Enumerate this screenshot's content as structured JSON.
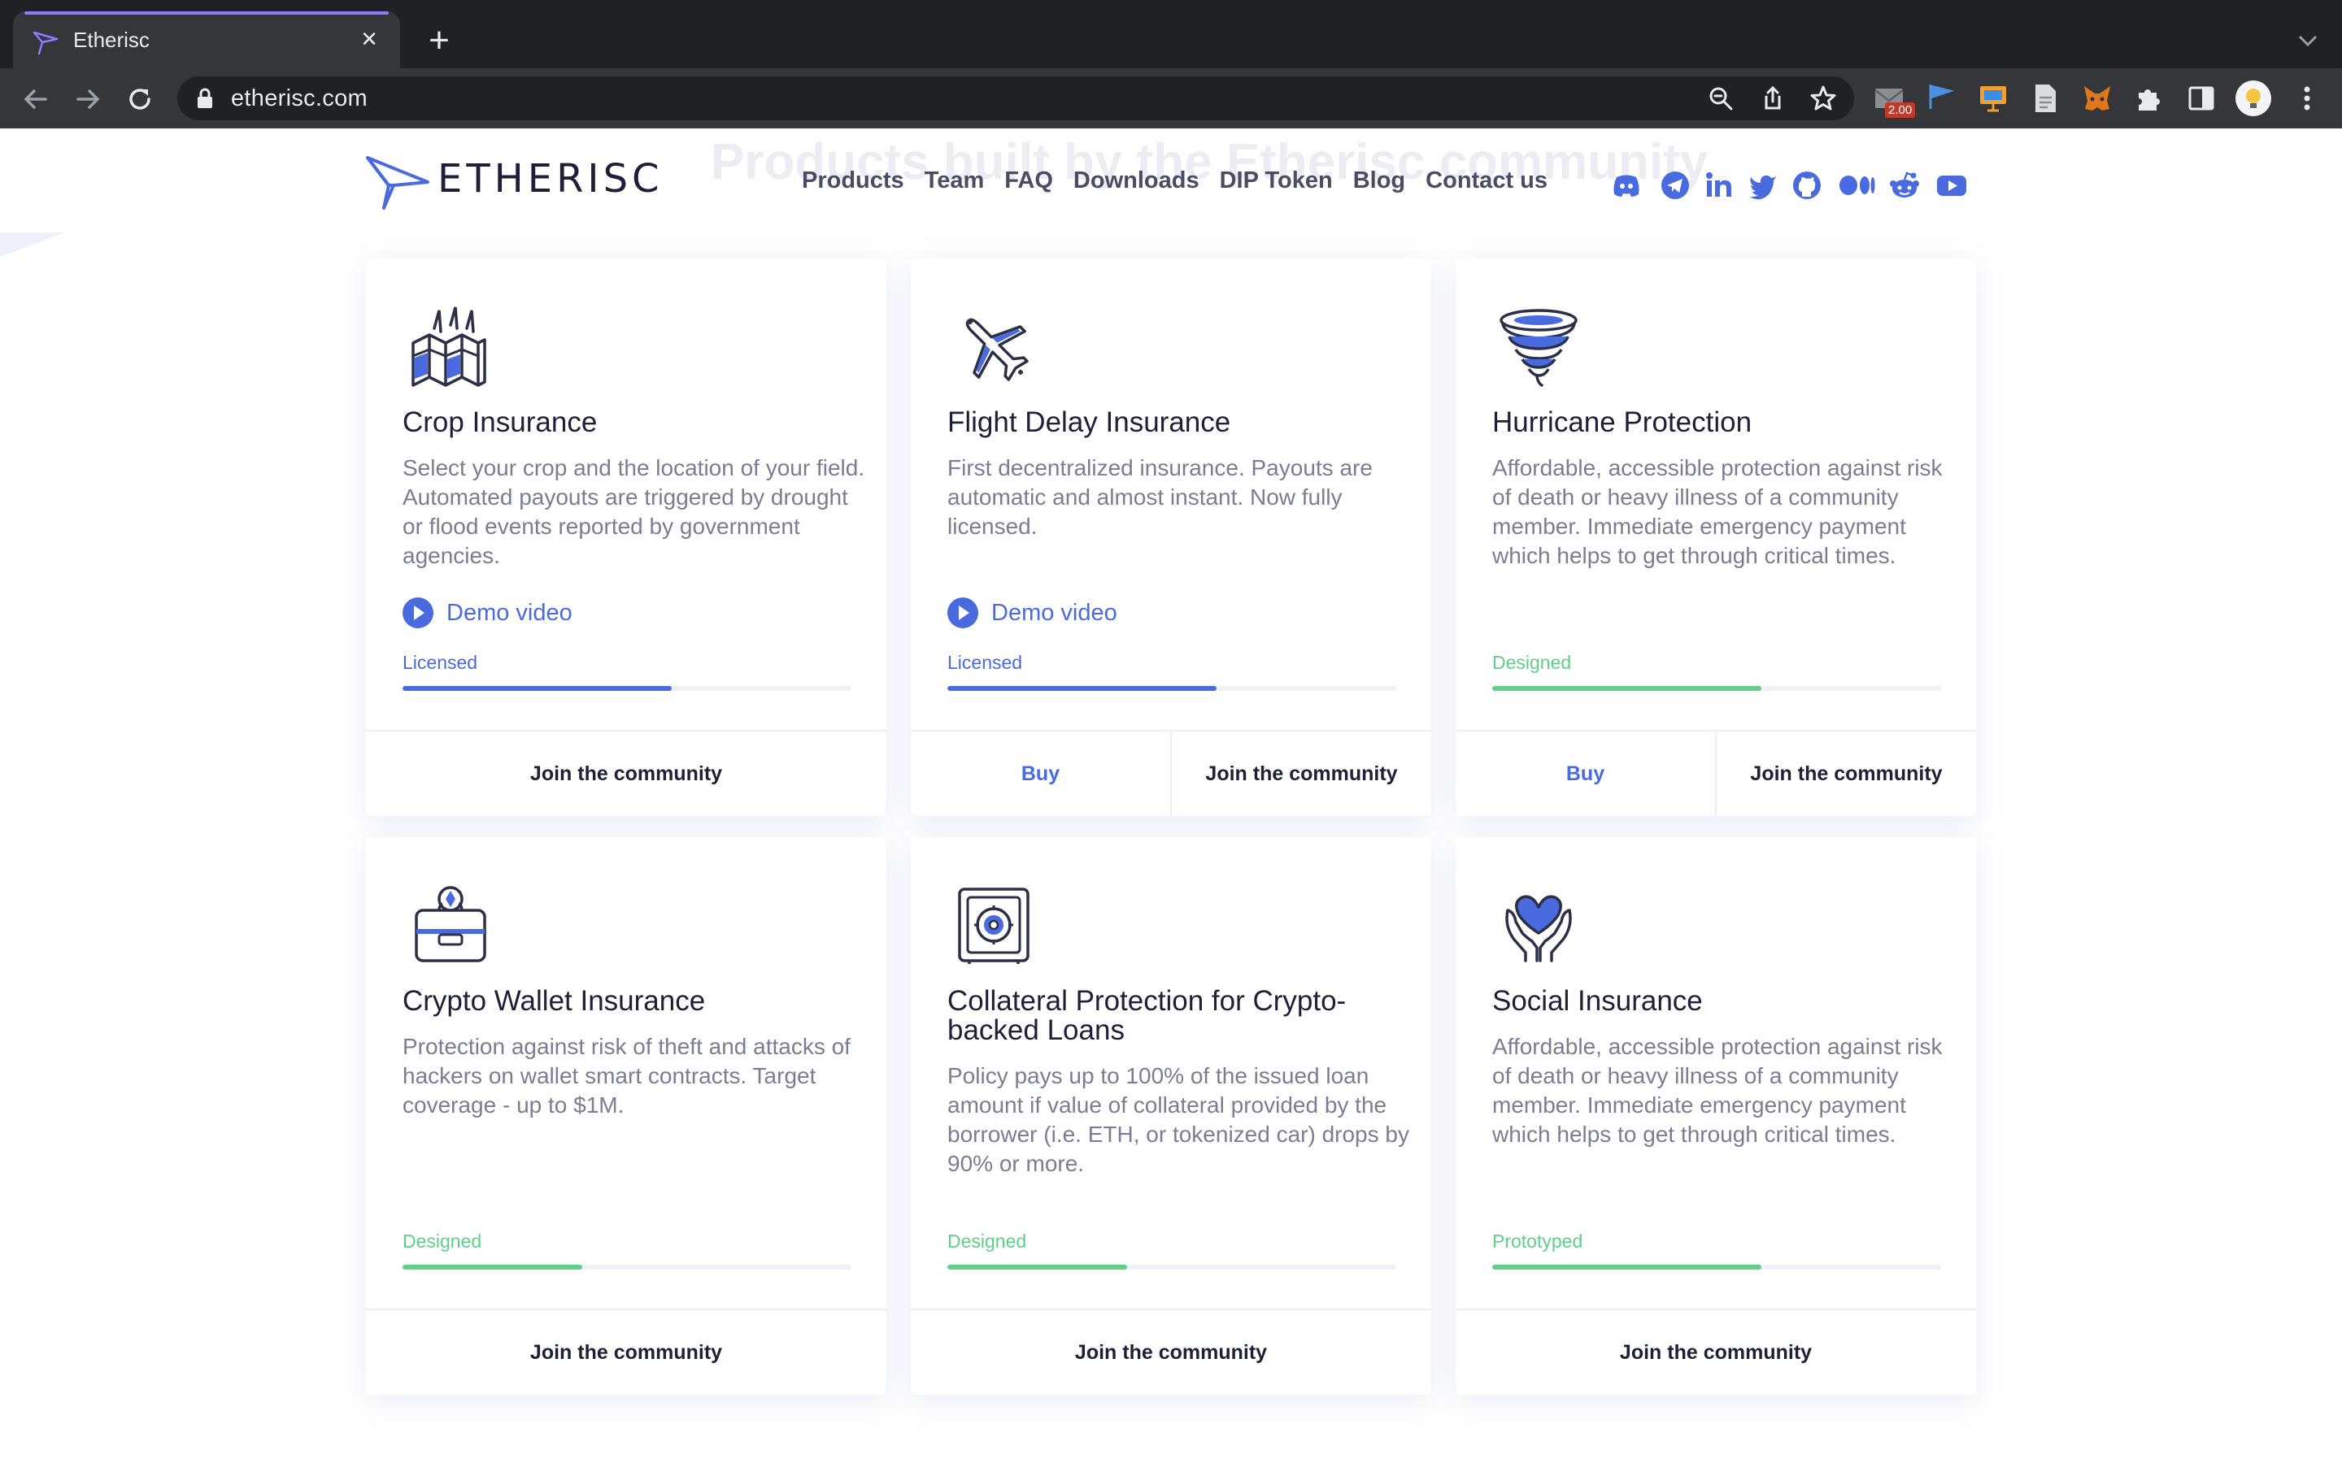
{
  "browser": {
    "tab_title": "Etherisc",
    "url": "etherisc.com",
    "extension_badge": "2.00",
    "icons": [
      "search-icon",
      "share-icon",
      "star-icon",
      "puzzle-icon",
      "sidepanel-icon",
      "more-icon"
    ]
  },
  "header": {
    "ghost_title": "Products built by the Etherisc community",
    "logo_text": "ETHERISC",
    "menu": [
      "Products",
      "Team",
      "FAQ",
      "Downloads",
      "DIP Token",
      "Blog",
      "Contact us"
    ],
    "social": [
      "discord-icon",
      "telegram-icon",
      "linkedin-icon",
      "twitter-icon",
      "github-icon",
      "medium-icon",
      "reddit-icon",
      "youtube-icon"
    ]
  },
  "colors": {
    "accent": "#4a6be0",
    "licensed": "#4a6be0",
    "designed": "#5fcf8a",
    "prototyped": "#5fcf8a"
  },
  "cards": [
    {
      "title": "Crop Insurance",
      "description": "Select your crop and the location of your field. Automated payouts are triggered by drought or flood events reported by government agencies.",
      "demo": "Demo video",
      "status": "Licensed",
      "progress": 0.6,
      "buy": null,
      "join": "Join the community",
      "icon": "crop-field-icon"
    },
    {
      "title": "Flight Delay Insurance",
      "description": "First decentralized insurance. Payouts are automatic and almost instant. Now fully licensed.",
      "demo": "Demo video",
      "status": "Licensed",
      "progress": 0.6,
      "buy": "Buy",
      "join": "Join the community",
      "icon": "airplane-icon"
    },
    {
      "title": "Hurricane Protection",
      "description": "Affordable, accessible protection against risk of death or heavy illness of a community member. Immediate emergency payment which helps to get through critical times.",
      "demo": null,
      "status": "Designed",
      "progress": 0.6,
      "buy": "Buy",
      "join": "Join the community",
      "icon": "hurricane-icon"
    },
    {
      "title": "Crypto Wallet Insurance",
      "description": "Protection against risk of theft and attacks of hackers on wallet smart contracts. Target coverage - up to $1M.",
      "demo": null,
      "status": "Designed",
      "progress": 0.4,
      "buy": null,
      "join": "Join the community",
      "icon": "wallet-icon"
    },
    {
      "title": "Collateral Protection for Crypto-backed Loans",
      "description": "Policy pays up to 100% of the issued loan amount if value of collateral provided by the borrower (i.e. ETH, or tokenized car) drops by 90% or more.",
      "demo": null,
      "status": "Designed",
      "progress": 0.4,
      "buy": null,
      "join": "Join the community",
      "icon": "safe-icon"
    },
    {
      "title": "Social Insurance",
      "description": "Affordable, accessible protection against risk of death or heavy illness of a community member. Immediate emergency payment which helps to get through critical times.",
      "demo": null,
      "status": "Prototyped",
      "progress": 0.6,
      "buy": null,
      "join": "Join the community",
      "icon": "heart-hands-icon"
    }
  ]
}
